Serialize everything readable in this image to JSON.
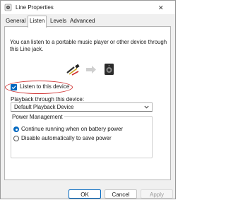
{
  "window": {
    "title": "Line Properties",
    "close_glyph": "✕"
  },
  "tabs": [
    {
      "label": "General",
      "active": false
    },
    {
      "label": "Listen",
      "active": true
    },
    {
      "label": "Levels",
      "active": false
    },
    {
      "label": "Advanced",
      "active": false
    }
  ],
  "listen": {
    "description": "You can listen to a portable music player or other device through this Line jack.",
    "checkbox_label": "Listen to this device",
    "checkbox_checked": true,
    "playback_label": "Playback through this device:",
    "playback_value": "Default Playback Device",
    "power_title": "Power Management",
    "radio_continue": "Continue running when on battery power",
    "radio_disable": "Disable automatically to save power",
    "selected_radio": "continue"
  },
  "buttons": {
    "ok": "OK",
    "cancel": "Cancel",
    "apply": "Apply"
  },
  "colors": {
    "accent": "#0067c0",
    "highlight_circle": "#d23a3a"
  },
  "icons": [
    "speaker-app-icon",
    "line-cable-icon",
    "arrow-right-icon",
    "speaker-device-icon",
    "chevron-down-icon",
    "checkmark-icon"
  ]
}
